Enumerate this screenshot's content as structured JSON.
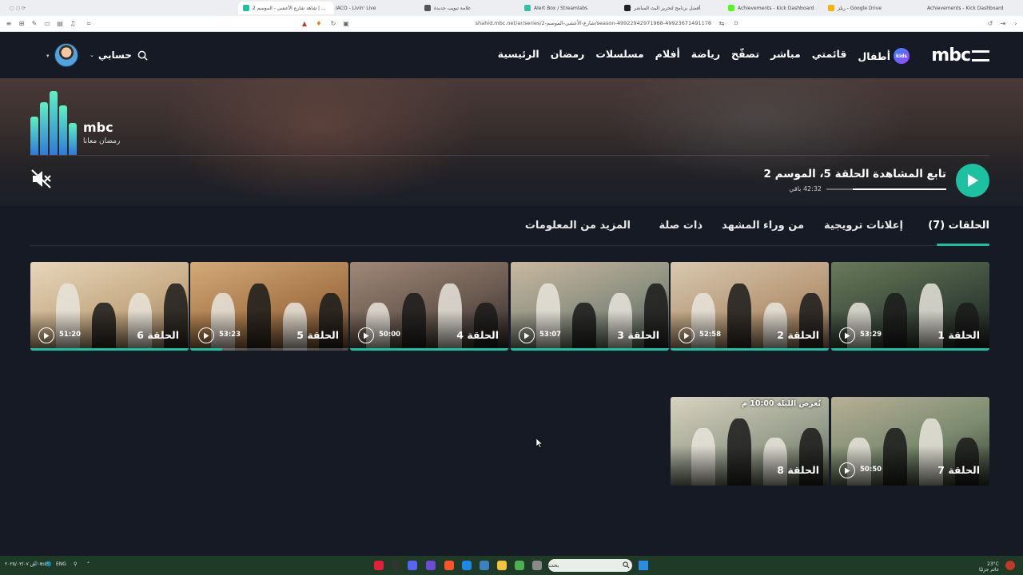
{
  "browser": {
    "tabs": [
      {
        "label": "Achievements - Kick Dashboard",
        "color": "#2f8f3a"
      },
      {
        "label": "ريلز - Google Drive",
        "color": "#f4b400"
      },
      {
        "label": "Achievements - Kick Dashboard",
        "color": "#53fc18"
      },
      {
        "label": "أفضل برنامج لتحرير البث المباشر",
        "color": "#222222"
      },
      {
        "label": "Alert Box / Streamlabs",
        "color": "#31c3a2"
      },
      {
        "label": "علامة تبويب جديدة",
        "color": "#555555"
      },
      {
        "label": "IACO - Livin' Live",
        "color": "#7b3fe4"
      },
      {
        "label": "شاهد شارع الأعشى - الموسم 2 | ...",
        "color": "#1bc1a1"
      }
    ],
    "url": "shahid.mbc.net/ar/series/شارع-الأعشى-الموسم-2/season-499229429719​68-49923671491178"
  },
  "header": {
    "logo": "mbc",
    "nav": [
      "الرئيسية",
      "رمضان",
      "مسلسلات",
      "أفلام",
      "رياضة",
      "تصفّح",
      "مباشر",
      "قائمتي"
    ],
    "kids_label": "أطفال",
    "kids_badge": "kids",
    "account_label": "حسابي"
  },
  "hero": {
    "brand_logo_text": "mbc",
    "brand_tagline": "رمضان معانا",
    "continue_title": "تابع المشاهدة الحلقة 5، الموسم 2",
    "remaining": "42:32 باقي",
    "progress": 0.78
  },
  "tabs": {
    "episodes": "الحلقات (7)",
    "trailers": "إعلانات ترويجية",
    "behind": "من وراء المشهد",
    "related": "ذات صلة",
    "more_info": "المزيد من المعلومات"
  },
  "episodes": [
    {
      "title": "الحلقة 1",
      "duration": "53:29",
      "progress": 1.0
    },
    {
      "title": "الحلقة 2",
      "duration": "52:58",
      "progress": 1.0
    },
    {
      "title": "الحلقة 3",
      "duration": "53:07",
      "progress": 1.0
    },
    {
      "title": "الحلقة 4",
      "duration": "50:00",
      "progress": 1.0
    },
    {
      "title": "الحلقة 5",
      "duration": "53:23",
      "progress": 0.2
    },
    {
      "title": "الحلقة 6",
      "duration": "51:20",
      "progress": 1.0
    },
    {
      "title": "الحلقة 7",
      "duration": "50:50",
      "progress": 0
    },
    {
      "title": "الحلقة 8",
      "duration": "",
      "progress": 0,
      "badge": "تُعرض الليلة 10:00 م"
    }
  ],
  "taskbar": {
    "search_placeholder": "بحث",
    "lang": "ENG",
    "weather": "23°C",
    "weather_desc": "غائم جزئيًا",
    "time": "٠٣:٥٩ ص",
    "date": "٢٠٢٥/٠٣/٠٧"
  },
  "colors": {
    "accent": "#1bc1a1",
    "background": "#151a24"
  }
}
